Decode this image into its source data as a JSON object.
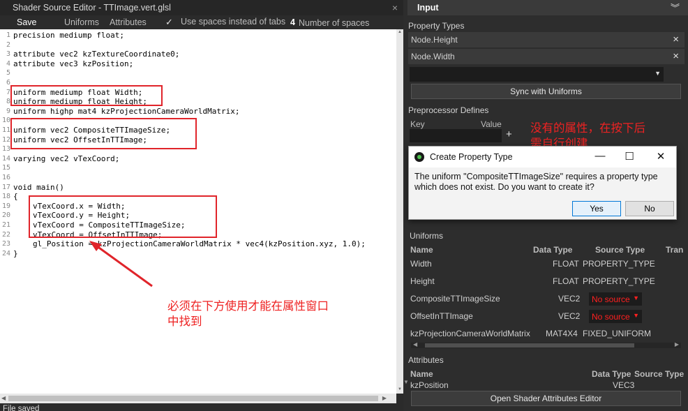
{
  "editor": {
    "title": "Shader Source Editor - TTImage.vert.glsl",
    "close": "×",
    "toolbar": {
      "save": "Save",
      "uniforms": "Uniforms",
      "attributes": "Attributes",
      "use_spaces_check": "✓",
      "use_spaces": "Use spaces instead of tabs",
      "num_spaces_value": "4",
      "num_spaces": "Number of spaces"
    },
    "code_lines": [
      "precision mediump float;",
      "",
      "attribute vec2 kzTextureCoordinate0;",
      "attribute vec3 kzPosition;",
      "",
      "",
      "uniform mediump float Width;",
      "uniform mediump float Height;",
      "uniform highp mat4 kzProjectionCameraWorldMatrix;",
      "",
      "uniform vec2 CompositeTTImageSize;",
      "uniform vec2 OffsetInTTImage;",
      "",
      "varying vec2 vTexCoord;",
      "",
      "",
      "void main()",
      "{",
      "vTexCoord.x = Width;",
      "vTexCoord.y = Height;",
      "vTexCoord = CompositeTTImageSize;",
      "vTexCoord = OffsetInTTImage;",
      "gl_Position = kzProjectionCameraWorldMatrix * vec4(kzPosition.xyz, 1.0);",
      "}"
    ],
    "status": "File saved"
  },
  "annotations": {
    "top_right": "没有的属性，在按下后\n需自行创建",
    "bottom_left": "必须在下方使用才能在属性窗口\n中找到"
  },
  "panel": {
    "header": "Input",
    "property_types_label": "Property Types",
    "property_types": [
      "Node.Height",
      "Node.Width"
    ],
    "remove_icon": "×",
    "sync_button": "Sync with Uniforms",
    "preprocessor_label": "Preprocessor Defines",
    "key_label": "Key",
    "value_label": "Value",
    "add_icon": "+",
    "partial_hidden": "Shader",
    "uniforms_label": "Uniforms",
    "uniform_columns": [
      "Name",
      "Data Type",
      "Source Type",
      "Tran"
    ],
    "uniforms": [
      {
        "name": "Width",
        "type": "FLOAT",
        "source": "PROPERTY_TYPE"
      },
      {
        "name": "Height",
        "type": "FLOAT",
        "source": "PROPERTY_TYPE"
      },
      {
        "name": "CompositeTTImageSize",
        "type": "VEC2",
        "source": "No source"
      },
      {
        "name": "OffsetInTTImage",
        "type": "VEC2",
        "source": "No source"
      },
      {
        "name": "kzProjectionCameraWorldMatrix",
        "type": "MAT4X4",
        "source": "FIXED_UNIFORM"
      }
    ],
    "attributes_label": "Attributes",
    "attribute_columns": [
      "Name",
      "Data Type",
      "Source Type"
    ],
    "attributes": [
      {
        "name": "kzPosition",
        "type": "VEC3"
      }
    ],
    "open_attr_button": "Open Shader Attributes Editor"
  },
  "dialog": {
    "title": "Create Property Type",
    "minimize": "—",
    "maximize": "☐",
    "close": "✕",
    "message": "The uniform \"CompositeTTImageSize\" requires a property type which does not exist. Do you want to create it?",
    "yes": "Yes",
    "no": "No"
  },
  "colors": {
    "annotation_red": "#e0242a",
    "dialog_accent": "#0078d7",
    "no_source_red": "#ff2020"
  }
}
